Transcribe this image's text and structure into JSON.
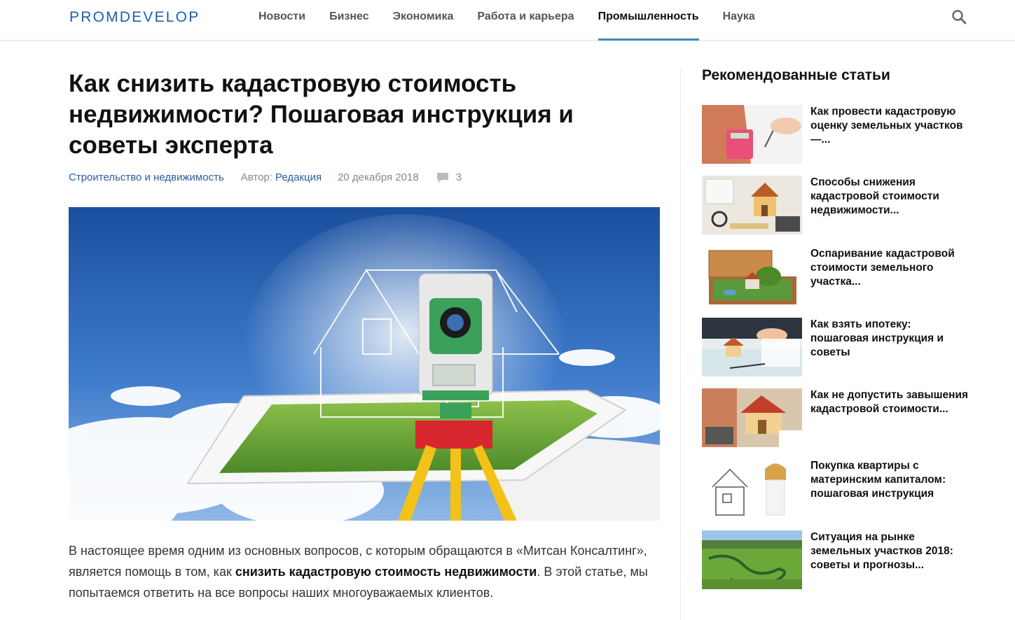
{
  "header": {
    "logo": "PROMDEVELOP",
    "nav": [
      {
        "label": "Новости"
      },
      {
        "label": "Бизнес"
      },
      {
        "label": "Экономика"
      },
      {
        "label": "Работа и карьера"
      },
      {
        "label": "Промышленность"
      },
      {
        "label": "Наука"
      }
    ],
    "active_nav": "Промышленность"
  },
  "article": {
    "title": "Как снизить кадастровую стоимость недвижимости? Пошаговая инструкция и советы эксперта",
    "category": "Строительство и недвижимость",
    "author_label": "Автор:",
    "author": "Редакция",
    "date": "20 декабря 2018",
    "comments_count": "3",
    "body_before": "В настоящее время одним из основных вопросов, с которым обращаются в «Митсан Консалтинг», является помощь в том, как ",
    "body_bold": "снизить кадастровую стоимость недвижимости",
    "body_after": ". В этой статье, мы попытаемся ответить на все вопросы наших многоуважаемых клиентов."
  },
  "sidebar": {
    "title": "Рекомендованные статьи",
    "items": [
      {
        "title": "Как провести кадастровую оценку земельных участков —..."
      },
      {
        "title": "Способы снижения кадастровой стоимости недвижимости..."
      },
      {
        "title": "Оспаривание кадастровой стоимости земельного участка..."
      },
      {
        "title": "Как взять ипотеку: пошаговая инструкция и советы"
      },
      {
        "title": "Как не допустить завышения кадастровой стоимости..."
      },
      {
        "title": "Покупка квартиры с материнским капиталом: пошаговая инструкция"
      },
      {
        "title": "Ситуация на рынке земельных участков 2018: советы и прогнозы..."
      }
    ]
  },
  "colors": {
    "accent": "#3a8bbf",
    "link": "#2a5d9f",
    "logo": "#1f5fa8"
  }
}
